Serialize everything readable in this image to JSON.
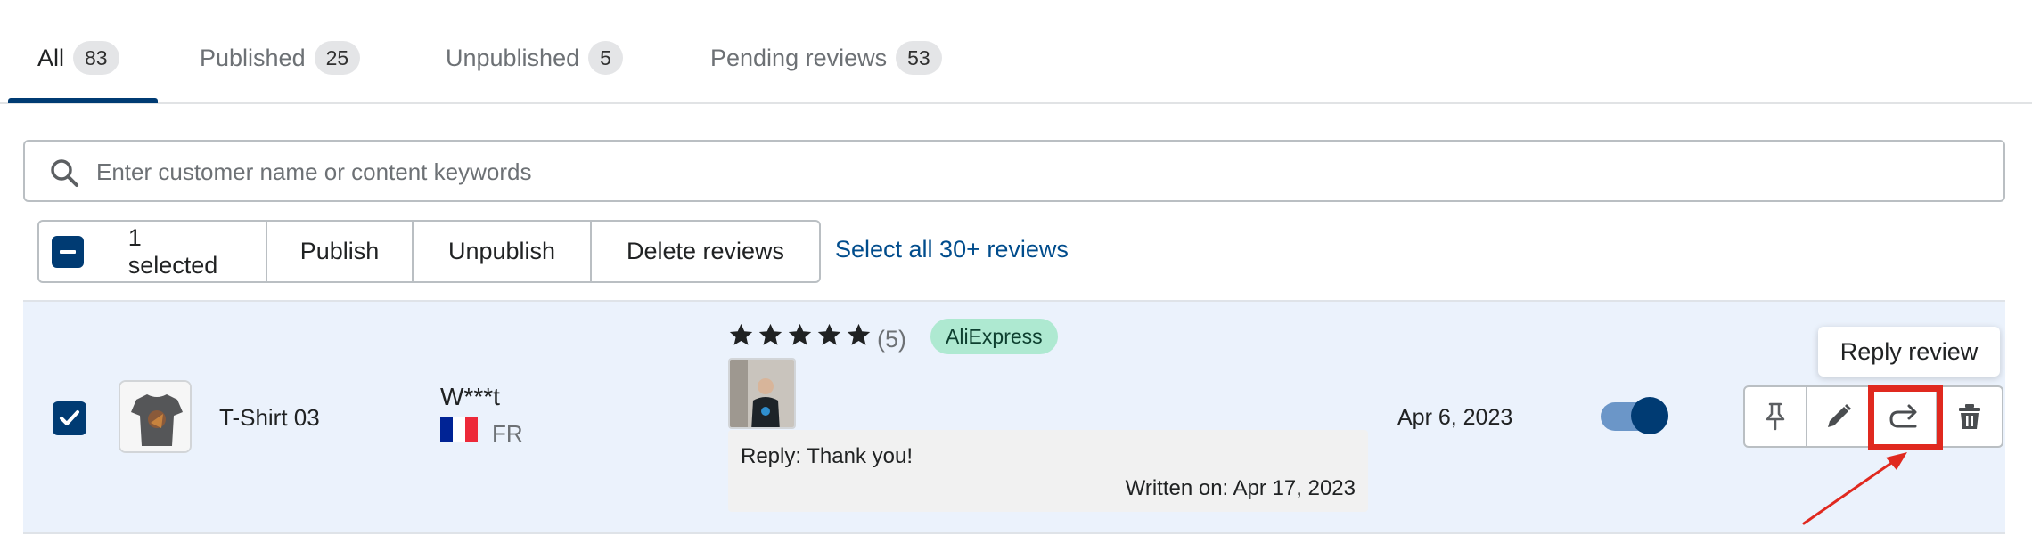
{
  "tabs": [
    {
      "label": "All",
      "count": "83"
    },
    {
      "label": "Published",
      "count": "25"
    },
    {
      "label": "Unpublished",
      "count": "5"
    },
    {
      "label": "Pending reviews",
      "count": "53"
    }
  ],
  "search": {
    "placeholder": "Enter customer name or content keywords",
    "icon": "search-icon"
  },
  "bulk": {
    "selected_label": "1 selected",
    "publish_label": "Publish",
    "unpublish_label": "Unpublish",
    "delete_label": "Delete reviews",
    "select_all_label": "Select all 30+ reviews"
  },
  "row": {
    "checked": true,
    "product_name": "T-Shirt 03",
    "customer_name": "W***t",
    "country": "FR",
    "rating": 5,
    "rating_text": "(5)",
    "source": "AliExpress",
    "reply_text": "Reply: Thank you!",
    "reply_date": "Written on: Apr 17, 2023",
    "date": "Apr 6, 2023",
    "published": true
  },
  "actions": {
    "icons": [
      "pin-icon",
      "edit-icon",
      "reply-icon",
      "trash-icon"
    ],
    "tooltip": "Reply review"
  },
  "colors": {
    "accent": "#003b73",
    "row_bg": "#ebf2fc",
    "badge_bg": "#aee9d1",
    "highlight": "#e0291f"
  }
}
